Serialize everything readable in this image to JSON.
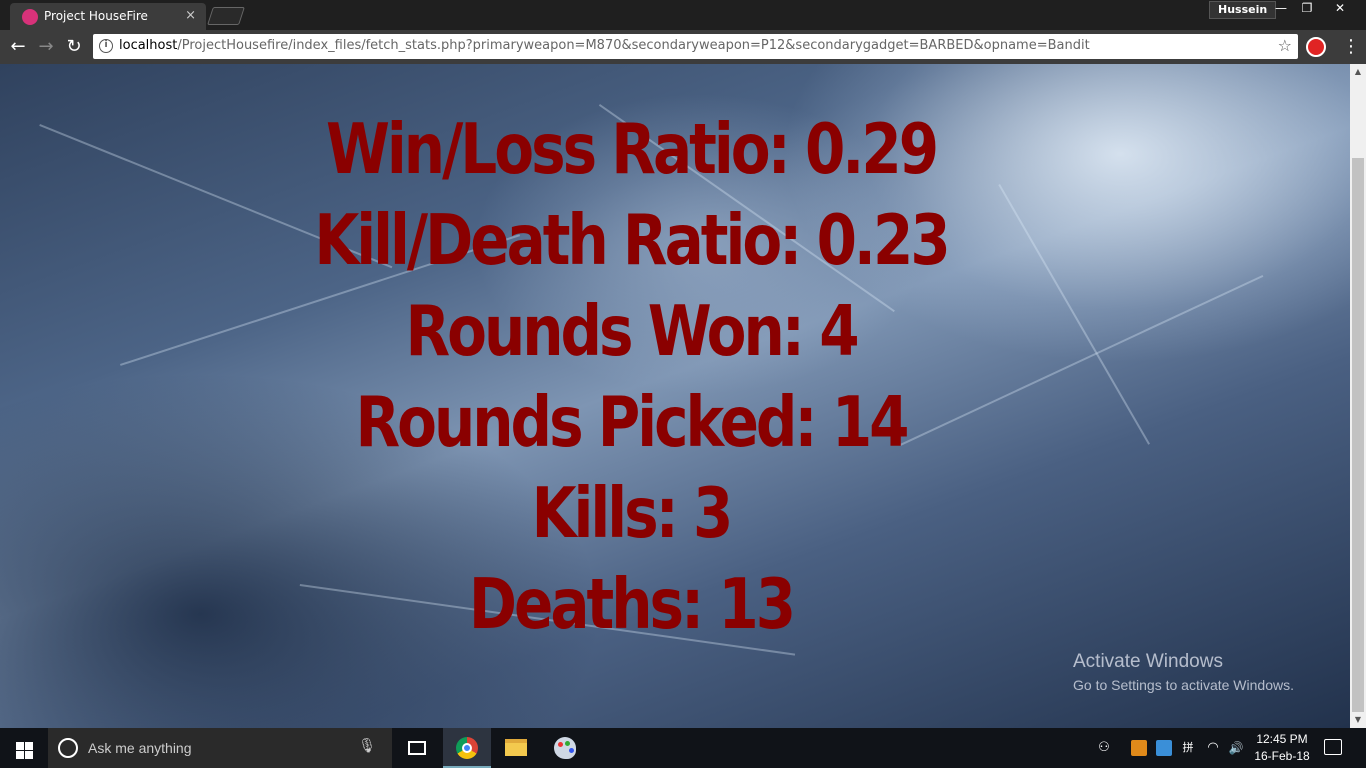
{
  "browser": {
    "tab_title": "Project HouseFire",
    "tab_close": "×",
    "profile_name": "Hussein",
    "window_controls": {
      "minimize": "—",
      "maximize": "❐",
      "close": "✕"
    },
    "nav": {
      "back": "←",
      "forward": "→",
      "reload": "↻"
    },
    "url_host": "localhost",
    "url_path": "/ProjectHousefire/index_files/fetch_stats.php?primaryweapon=M870&secondaryweapon=P12&secondarygadget=BARBED&opname=Bandit",
    "bookmark_star": "☆",
    "menu": "⋮"
  },
  "stats": [
    "Win/Loss Ratio: 0.29",
    "Kill/Death Ratio: 0.23",
    "Rounds Won: 4",
    "Rounds Picked: 14",
    "Kills: 3",
    "Deaths: 13"
  ],
  "watermark": {
    "title": "Activate Windows",
    "subtitle": "Go to Settings to activate Windows."
  },
  "scrollbar": {
    "up": "▲",
    "down": "▼"
  },
  "taskbar": {
    "search_placeholder": "Ask me anything",
    "mic": "🎙",
    "tray": {
      "people": "⚇",
      "lang": "拼",
      "wifi": "◠",
      "volume": "🔊"
    },
    "clock_time": "12:45 PM",
    "clock_date": "16-Feb-18"
  },
  "colors": {
    "stat_text": "#8a0000",
    "chrome_bg": "#3c3c3c",
    "taskbar_bg": "#101318"
  }
}
